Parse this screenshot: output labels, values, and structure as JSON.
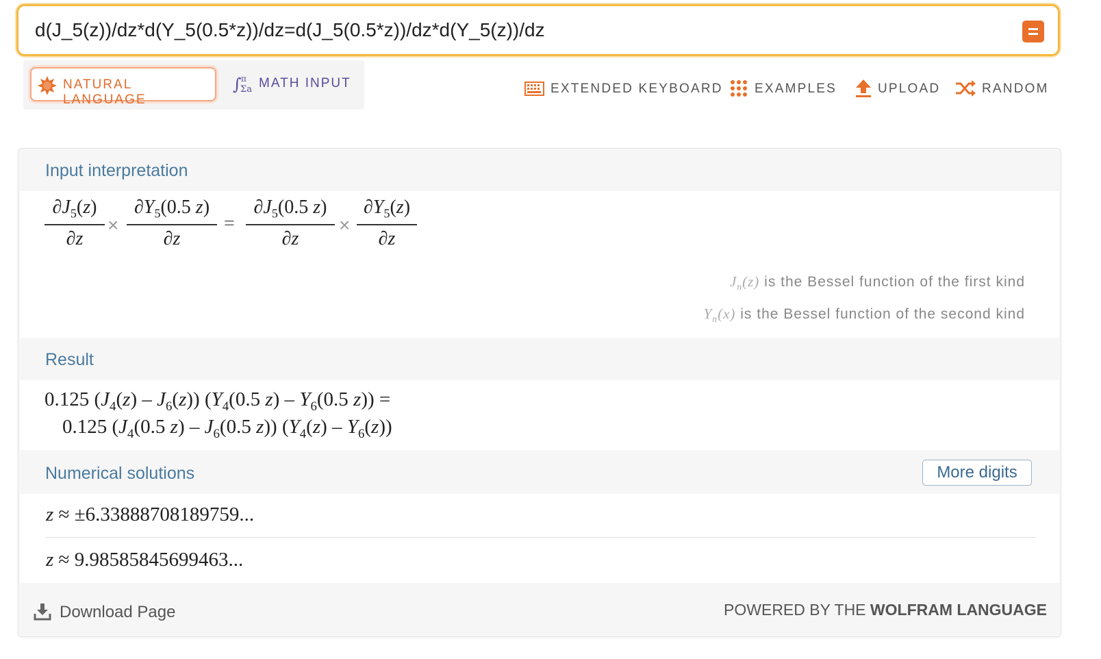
{
  "search": {
    "query": "d(J_5(z))/dz*d(Y_5(0.5*z))/dz=d(J_5(0.5*z))/dz*d(Y_5(z))/dz",
    "submit_icon": "equals-icon"
  },
  "mode_tabs": {
    "natural_language": "NATURAL LANGUAGE",
    "math_input": "MATH INPUT"
  },
  "toolbar": {
    "extended_keyboard": "EXTENDED KEYBOARD",
    "examples": "EXAMPLES",
    "upload": "UPLOAD",
    "random": "RANDOM"
  },
  "pods": {
    "input_interpretation": {
      "title": "Input interpretation",
      "notes": [
        {
          "symbol": "J",
          "sub": "n",
          "arg": "(z)",
          "text": "is the Bessel function of the first kind"
        },
        {
          "symbol": "Y",
          "sub": "n",
          "arg": "(x)",
          "text": "is the Bessel function of the second kind"
        }
      ]
    },
    "result": {
      "title": "Result"
    },
    "numerical_solutions": {
      "title": "Numerical solutions",
      "more_digits": "More digits",
      "solutions": [
        "±6.33888708189759...",
        "9.98585845699463..."
      ]
    }
  },
  "footer": {
    "download": "Download Page",
    "powered_prefix": "POWERED BY THE",
    "powered_brand": "WOLFRAM LANGUAGE"
  },
  "colors": {
    "accent_orange": "#e8702a",
    "search_border": "#f5b942",
    "pod_title": "#4a7aa0",
    "math_input_purple": "#5a4a9a"
  }
}
